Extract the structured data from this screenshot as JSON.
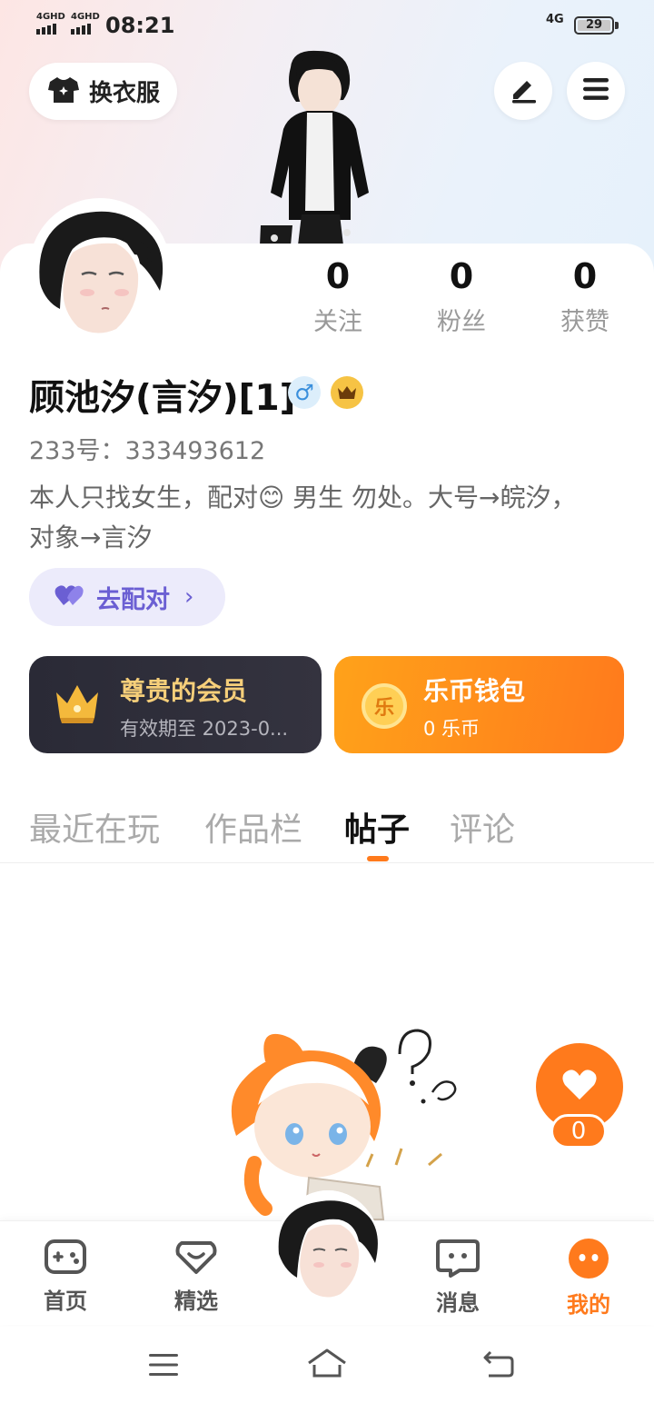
{
  "status_bar": {
    "sim1": "4GHD",
    "sim2": "4GHD",
    "time": "08:21",
    "network": "4G",
    "battery": "29"
  },
  "header": {
    "outfit_label": "换衣服"
  },
  "profile": {
    "stats": [
      {
        "value": "0",
        "label": "关注"
      },
      {
        "value": "0",
        "label": "粉丝"
      },
      {
        "value": "0",
        "label": "获赞"
      }
    ],
    "username": "顾池汐(言汐)[1]",
    "gender_symbol": "♂",
    "uid": "233号：333493612",
    "bio": "本人只找女生，配对😊 男生  勿处。大号→皖汐，对象→言汐",
    "pair_button": "去配对"
  },
  "cards": {
    "vip_title": "尊贵的会员",
    "vip_sub": "有效期至 2023-0...",
    "wallet_title": "乐币钱包",
    "wallet_sub": "0 乐币",
    "coin_glyph": "乐"
  },
  "tabs": [
    {
      "label": "最近在玩"
    },
    {
      "label": "作品栏"
    },
    {
      "label": "帖子",
      "active": true
    },
    {
      "label": "评论"
    }
  ],
  "like": {
    "count": "0"
  },
  "bottom_nav": [
    {
      "label": "首页",
      "icon": "gamepad-icon"
    },
    {
      "label": "精选",
      "icon": "heart-box-icon"
    },
    {
      "label": "消息",
      "icon": "chat-icon"
    },
    {
      "label": "我的",
      "icon": "face-icon",
      "active": true
    }
  ],
  "colors": {
    "accent": "#ff7a1c",
    "pair": "#6b5fd3",
    "vip_gold": "#f6cf7a"
  }
}
